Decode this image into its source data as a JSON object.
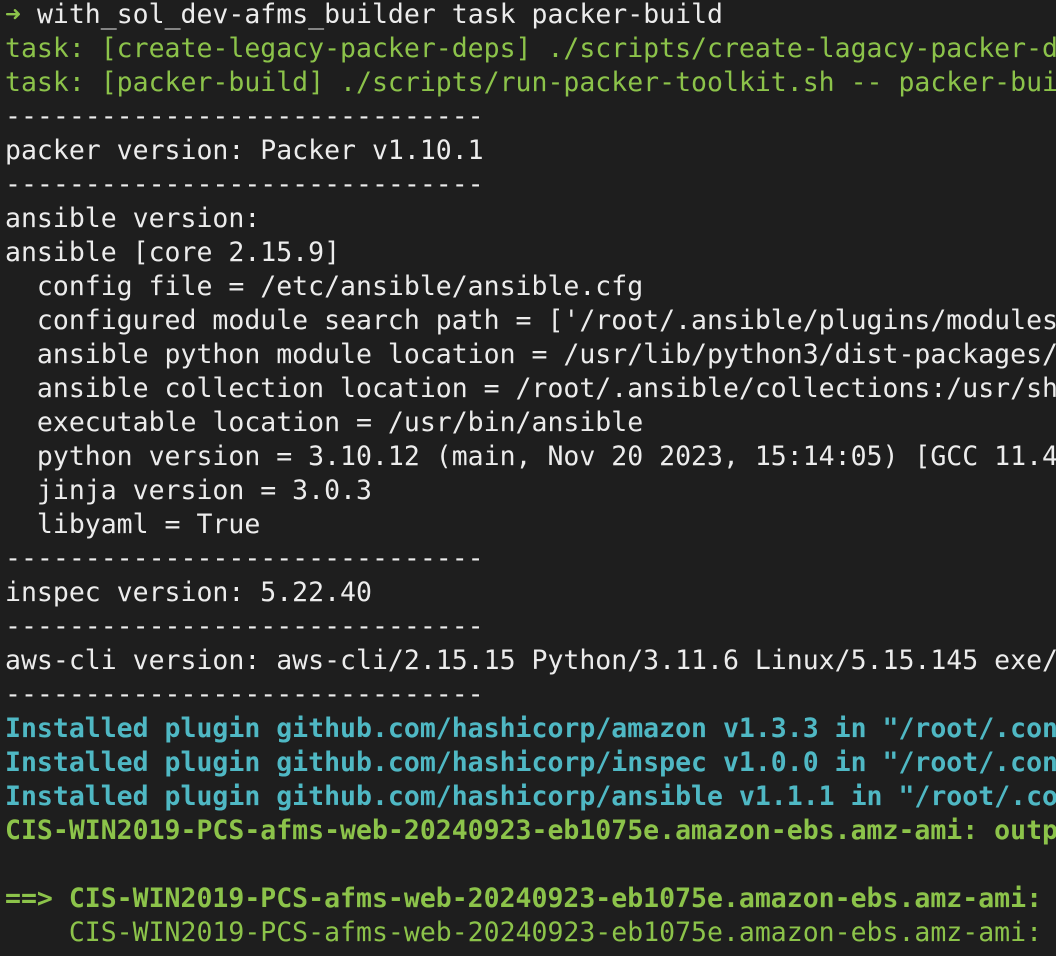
{
  "terminal": {
    "prompt": {
      "arrow": "➜",
      "command": "with_sol_dev-afms_builder task packer-build"
    },
    "lines": [
      {
        "text": "task: [create-legacy-packer-deps] ./scripts/create-lagacy-packer-d",
        "style": "green"
      },
      {
        "text": "task: [packer-build] ./scripts/run-packer-toolkit.sh -- packer-bui",
        "style": "green"
      },
      {
        "text": "------------------------------",
        "style": "white"
      },
      {
        "text": "packer version: Packer v1.10.1",
        "style": "white"
      },
      {
        "text": "------------------------------",
        "style": "white"
      },
      {
        "text": "ansible version:",
        "style": "white"
      },
      {
        "text": "ansible [core 2.15.9]",
        "style": "white"
      },
      {
        "text": "  config file = /etc/ansible/ansible.cfg",
        "style": "white"
      },
      {
        "text": "  configured module search path = ['/root/.ansible/plugins/modules",
        "style": "white"
      },
      {
        "text": "  ansible python module location = /usr/lib/python3/dist-packages/",
        "style": "white"
      },
      {
        "text": "  ansible collection location = /root/.ansible/collections:/usr/sh",
        "style": "white"
      },
      {
        "text": "  executable location = /usr/bin/ansible",
        "style": "white"
      },
      {
        "text": "  python version = 3.10.12 (main, Nov 20 2023, 15:14:05) [GCC 11.4",
        "style": "white"
      },
      {
        "text": "  jinja version = 3.0.3",
        "style": "white"
      },
      {
        "text": "  libyaml = True",
        "style": "white"
      },
      {
        "text": "------------------------------",
        "style": "white"
      },
      {
        "text": "inspec version: 5.22.40",
        "style": "white"
      },
      {
        "text": "------------------------------",
        "style": "white"
      },
      {
        "text": "aws-cli version: aws-cli/2.15.15 Python/3.11.6 Linux/5.15.145 exe/",
        "style": "white"
      },
      {
        "text": "------------------------------",
        "style": "white"
      },
      {
        "text": "Installed plugin github.com/hashicorp/amazon v1.3.3 in \"/root/.con",
        "style": "cyan-bold"
      },
      {
        "text": "Installed plugin github.com/hashicorp/inspec v1.0.0 in \"/root/.con",
        "style": "cyan-bold"
      },
      {
        "text": "Installed plugin github.com/hashicorp/ansible v1.1.1 in \"/root/.co",
        "style": "cyan-bold"
      },
      {
        "text": "CIS-WIN2019-PCS-afms-web-20240923-eb1075e.amazon-ebs.amz-ami: outp",
        "style": "green-bold"
      },
      {
        "text": "",
        "style": "white"
      },
      {
        "text": "==> CIS-WIN2019-PCS-afms-web-20240923-eb1075e.amazon-ebs.amz-ami:",
        "style": "green-bold"
      },
      {
        "text": "    CIS-WIN2019-PCS-afms-web-20240923-eb1075e.amazon-ebs.amz-ami:",
        "style": "green"
      }
    ],
    "colors": {
      "background": "#1e1e1e",
      "text": "#ececec",
      "green": "#8cc34a",
      "cyan": "#4fb8c4"
    }
  }
}
